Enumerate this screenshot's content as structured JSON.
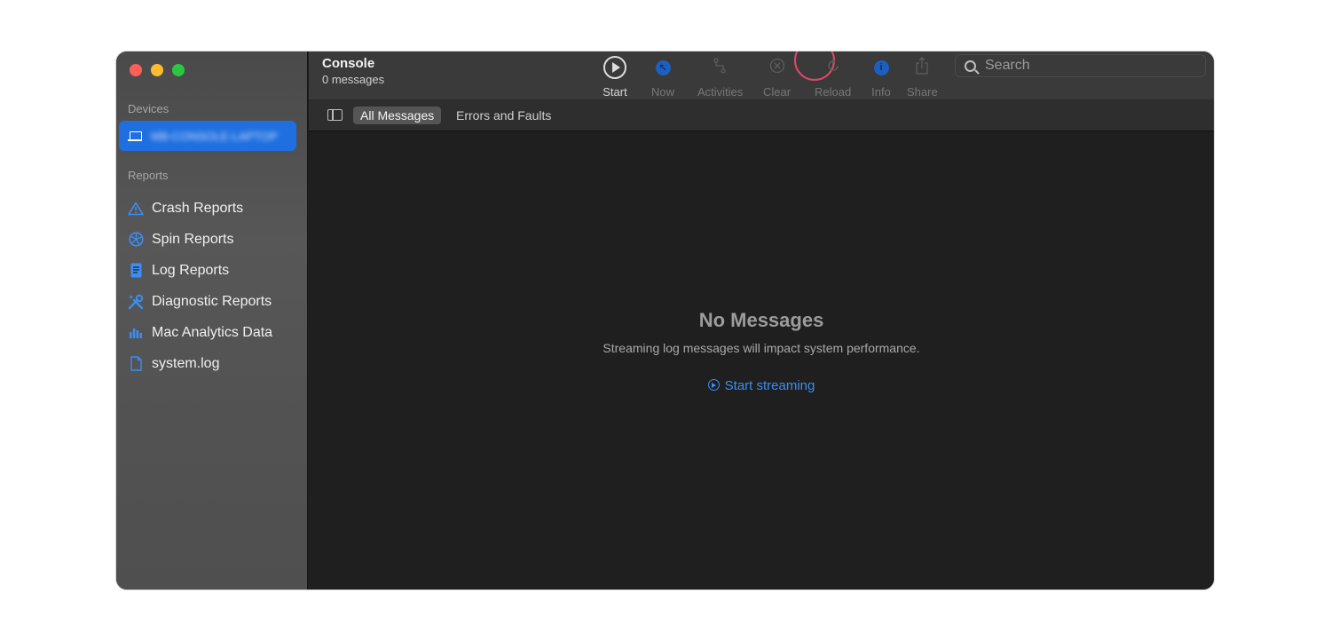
{
  "toolbar": {
    "title": "Console",
    "subtitle": "0 messages",
    "buttons": [
      {
        "label": "Start",
        "icon": "play-circle-icon",
        "enabled": true,
        "highlighted": true
      },
      {
        "label": "Now",
        "icon": "now-icon",
        "enabled": false
      },
      {
        "label": "Activities",
        "icon": "activities-icon",
        "enabled": false
      },
      {
        "label": "Clear",
        "icon": "clear-icon",
        "enabled": false
      },
      {
        "label": "Reload",
        "icon": "reload-icon",
        "enabled": false
      },
      {
        "label": "Info",
        "icon": "info-icon",
        "enabled": false
      },
      {
        "label": "Share",
        "icon": "share-icon",
        "enabled": false
      }
    ],
    "search_placeholder": "Search"
  },
  "sidebar": {
    "devices_title": "Devices",
    "device_name": "MB-CONSOLE-LAPTOP",
    "reports_title": "Reports",
    "reports": [
      {
        "label": "Crash Reports",
        "icon": "warning-triangle-icon"
      },
      {
        "label": "Spin Reports",
        "icon": "spinner-icon"
      },
      {
        "label": "Log Reports",
        "icon": "log-file-icon"
      },
      {
        "label": "Diagnostic Reports",
        "icon": "tools-icon"
      },
      {
        "label": "Mac Analytics Data",
        "icon": "bar-chart-icon"
      },
      {
        "label": "system.log",
        "icon": "document-icon"
      }
    ]
  },
  "filters": {
    "all_messages": "All Messages",
    "errors_faults": "Errors and Faults"
  },
  "empty_state": {
    "title": "No Messages",
    "subtitle": "Streaming log messages will impact system performance.",
    "link": "Start streaming"
  },
  "colors": {
    "accent": "#3a8ef6",
    "selection": "#1f6fe0",
    "highlight_ring": "#e0476a"
  }
}
